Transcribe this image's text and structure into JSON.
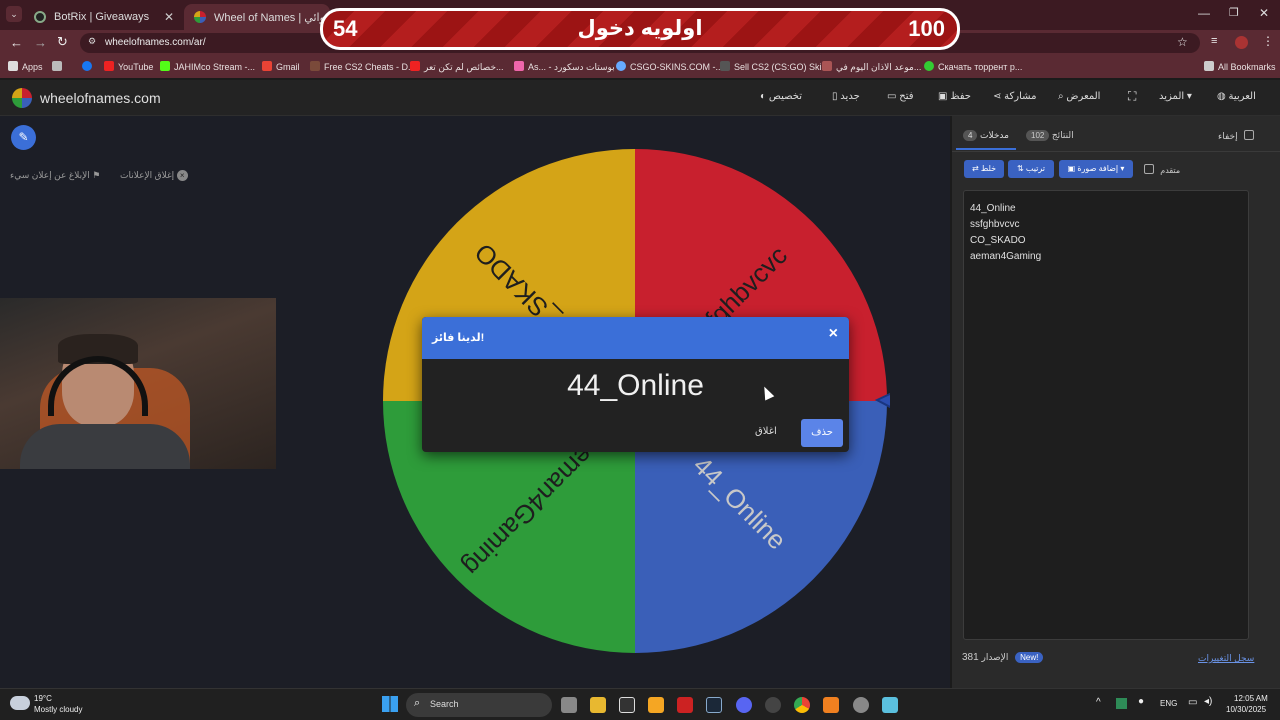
{
  "browser": {
    "tabs": [
      {
        "title": "BotRix | Giveaways",
        "active": false
      },
      {
        "title": "Wheel of Names | العشوائي",
        "active": true
      }
    ],
    "url": "wheelofnames.com/ar/",
    "bookmarks": [
      "Apps",
      "YouTube",
      "JAHIMco Stream -...",
      "Gmail",
      "Free CS2 Cheats - D...",
      "خصائص لم تكن تعر...",
      "As... - بوستات دسكورد",
      "CSGO-SKINS.COM -...",
      "Sell CS2 (CS:GO) Ski...",
      "موعد الاذان اليوم في...",
      "Скачать торрент р..."
    ],
    "all_bookmarks": "All Bookmarks"
  },
  "overlay": {
    "left_number": "54",
    "title": "اولويه دخول",
    "right_number": "100"
  },
  "site": {
    "logo_text": "wheelofnames.com",
    "nav": {
      "customize": "تخصيص",
      "new": "جديد",
      "open": "فتح",
      "save": "حفظ",
      "share": "مشاركة",
      "gallery": "المعرض",
      "more": "المزيد",
      "language": "العربية"
    }
  },
  "ads": {
    "close_ads": "إغلاق الإعلانات",
    "report_ad": "الإبلاغ عن إعلان سيء"
  },
  "wheel": {
    "segments": [
      {
        "label": "ssfghbvcvc",
        "color": "#c8202e"
      },
      {
        "label": "44_Online",
        "color": "#3a5fb8"
      },
      {
        "label": "aeman4Gaming",
        "color": "#2e9c3a"
      },
      {
        "label": "CO_SKADO",
        "color": "#d4a417"
      }
    ]
  },
  "dialog": {
    "title": "لدينا فائز!",
    "winner": "44_Online",
    "remove_label": "حذف",
    "close_label": "اغلاق",
    "close_icon": "×"
  },
  "panel": {
    "tab_entries": "مدخلات",
    "tab_entries_count": "4",
    "tab_results": "النتائج",
    "tab_results_count": "102",
    "hide_label": "إخفاء",
    "shuffle": "خلط",
    "sort": "ترتيب",
    "add_image": "إضافة صورة",
    "advanced": "متقدم",
    "entries": [
      "44_Online",
      "ssfghbvcvc",
      "CO_SKADO",
      "aeman4Gaming"
    ],
    "version_label": "الإصدار",
    "version_number": "381",
    "new_badge": "New!",
    "changelog": "سجل التغييرات"
  },
  "taskbar": {
    "temp": "19°C",
    "weather": "Mostly cloudy",
    "search_placeholder": "Search",
    "lang": "ENG",
    "time": "12:05 AM",
    "date": "10/30/2025"
  }
}
